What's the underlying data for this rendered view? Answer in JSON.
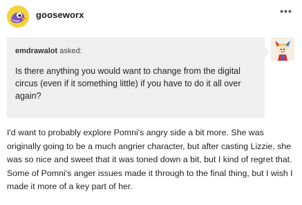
{
  "post": {
    "username": "gooseworx",
    "menu_label": "•••"
  },
  "ask": {
    "asker": "emdrawalot",
    "asked_label": "asked:",
    "question": "Is there anything you would want to change from the digital circus (even if it something little)  if you have to do it all over again?"
  },
  "answer": {
    "text": "I'd want to probably explore Pomni's angry side a bit more. She was originally going to be a much angrier character, but after casting Lizzie, she was so nice and sweet that it was toned down a bit, but I kind of regret that. Some of Pomni's anger issues made it through to the final thing, but I wish I made it more of a key part of her."
  },
  "colors": {
    "accent_yellow": "#f0d43a",
    "ask_background": "#efefef",
    "goose_purple": "#7b4fc7"
  },
  "icons": {
    "post_avatar": "goose-avatar-icon",
    "asker_avatar": "jester-avatar-icon",
    "menu": "more-options-icon"
  }
}
